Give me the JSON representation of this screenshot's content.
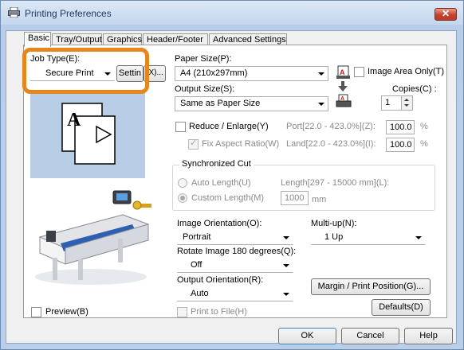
{
  "window": {
    "title": "Printing Preferences",
    "close_label": "✕"
  },
  "tabs": [
    "Basic",
    "Tray/Output",
    "Graphics",
    "Header/Footer",
    "Advanced Settings"
  ],
  "job_type": {
    "label": "Job Type(E):",
    "value": "Secure Print",
    "settings_label": "Settin",
    "ellipsis_label": "(X)..."
  },
  "paper_size": {
    "label": "Paper Size(P):",
    "value": "A4 (210x297mm)",
    "image_area_only": "Image Area Only(T)"
  },
  "output_size": {
    "label": "Output Size(S):",
    "value": "Same as Paper Size"
  },
  "copies": {
    "label": "Copies(C) :",
    "value": "1"
  },
  "reduce": {
    "label": "Reduce / Enlarge(Y)",
    "port_label": "Port[22.0 - 423.0%](Z):",
    "port_value": "100.0",
    "fix_aspect": "Fix Aspect Ratio(W)",
    "land_label": "Land[22.0 - 423.0%](I):",
    "land_value": "100.0",
    "percent": "%"
  },
  "sync_cut": {
    "legend": "Synchronized Cut",
    "auto": "Auto Length(U)",
    "custom": "Custom Length(M)",
    "length_label": "Length[297 - 15000 mm](L):",
    "length_value": "1000",
    "unit": "mm"
  },
  "image_orientation": {
    "label": "Image Orientation(O):",
    "value": "Portrait"
  },
  "multi_up": {
    "label": "Multi-up(N):",
    "value": "1 Up"
  },
  "rotate": {
    "label": "Rotate Image 180 degrees(Q):",
    "value": "Off"
  },
  "output_orientation": {
    "label": "Output Orientation(R):",
    "value": "Auto"
  },
  "margin_button": "Margin / Print Position(G)...",
  "defaults_button": "Defaults(D)",
  "preview": "Preview(B)",
  "print_to_file": "Print to File(H)",
  "footer": {
    "ok": "OK",
    "cancel": "Cancel",
    "help": "Help"
  },
  "preview_letter": "A",
  "colors": {
    "highlight": "#e8861e",
    "title_text": "#1e395b"
  }
}
